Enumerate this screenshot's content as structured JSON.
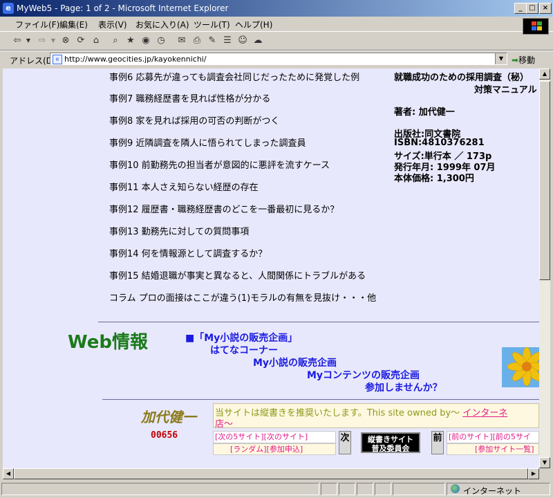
{
  "window": {
    "title": "MyWeb5 - Page: 1 of 2 - Microsoft Internet Explorer",
    "min_label": "_",
    "max_label": "□",
    "close_label": "×"
  },
  "menu": [
    "ファイル(F)",
    "編集(E)",
    "表示(V)",
    "お気に入り(A)",
    "ツール(T)",
    "ヘルプ(H)"
  ],
  "address": {
    "label": "アドレス(D)",
    "url": "http://www.geocities.jp/kayokennichi/",
    "go": "移動"
  },
  "cases": [
    "事例6 応募先が違っても調査会社同じだったために発覚した例",
    "事例7 職務経歴書を見れば性格が分かる",
    "事例8 家を見れば採用の可否の判断がつく",
    "事例9 近隣調査を隣人に悟られてしまった調査員",
    "事例10 前勤務先の担当者が意図的に悪評を流すケース",
    "事例11 本人さえ知らない経歴の存在",
    "事例12 履歴書・職務経歴書のどこを一番最初に見るか？",
    "事例13 勤務先に対しての質問事項",
    "事例14 何を情報源として調査するか？",
    "事例15 結婚退職が事実と異なると、人間関係にトラブルがある",
    "コラム プロの面接はここが違う(1)モラルの有無を見抜け・・・他"
  ],
  "book": {
    "title1": "就職成功のための採用調査（秘）",
    "title2": "対策マニュアル",
    "author": "著者: 加代健一",
    "publisher": "出版社:同文書院",
    "isbn": "ISBN:4810376281",
    "size": "サイズ:単行本 ／ 173p",
    "date": "発行年月: 1999年 07月",
    "price": "本体価格: 1,300円"
  },
  "web": {
    "heading": "Web情報",
    "link1": "■「My小説の販売企画」",
    "link2": "はてなコーナー",
    "link3": "My小説の販売企画",
    "link4": "Myコンテンツの販売企画",
    "link5": "参加しませんか？"
  },
  "footer": {
    "author_name": "加代健一",
    "counter": "00656",
    "notice_text": "当サイトは縦書きを推奨いたします。This site owned by～",
    "notice_link": "インターネ",
    "notice_line2": "店～",
    "ring_left_top": "[次の5サイト][次のサイト]",
    "ring_left_bottom": "[ランダム][参加申込]",
    "next_kanji": "次",
    "banner_line1": "縦書きサイト",
    "banner_line2": "普及委員会",
    "prev_kanji": "前",
    "ring_right_top": "[前のサイト][前の5サイ",
    "ring_right_bottom": "[参加サイト一覧]"
  },
  "status": {
    "zone": "インターネット"
  }
}
